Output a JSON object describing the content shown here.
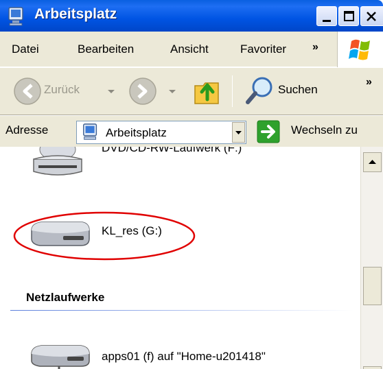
{
  "window": {
    "title": "Arbeitsplatz"
  },
  "menu": {
    "items": [
      "Datei",
      "Bearbeiten",
      "Ansicht",
      "Favoriter"
    ],
    "overflow": "»"
  },
  "toolbar": {
    "back_label": "Zurück",
    "search_label": "Suchen",
    "overflow": "»"
  },
  "address": {
    "label": "Adresse",
    "value": "Arbeitsplatz",
    "go_label": "Wechseln zu"
  },
  "content": {
    "items": [
      {
        "label": "DVD/CD-RW-Laufwerk (F:)",
        "icon": "cd-drive-icon"
      },
      {
        "label": "KL_res (G:)",
        "icon": "removable-drive-icon"
      }
    ],
    "group_header": "Netzlaufwerke",
    "network_items": [
      {
        "label": "apps01 (f) auf \"Home-u201418\"",
        "icon": "network-drive-icon"
      }
    ]
  },
  "colors": {
    "titlebar": "#0054e3",
    "highlight_ellipse": "#e00000",
    "chrome": "#ece9d8"
  }
}
